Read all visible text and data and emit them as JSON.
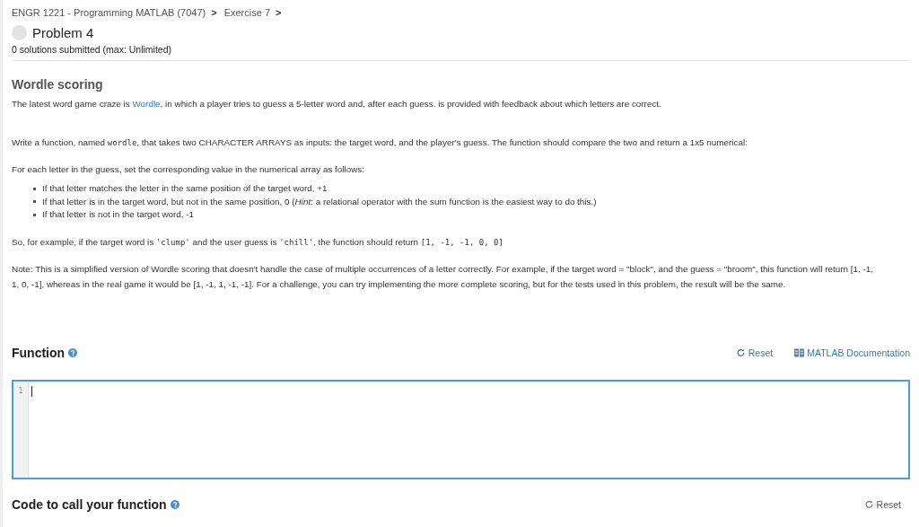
{
  "breadcrumb": [
    {
      "label": "ENGR 1221 - Programming MATLAB (7047)",
      "separator": ">"
    },
    {
      "label": "Exercise 7",
      "separator": ">"
    }
  ],
  "problem": {
    "title": "Problem 4",
    "submitted": "0 solutions submitted (max: Unlimited)"
  },
  "description": {
    "heading": "Wordle scoring",
    "paragraphs": [
      {
        "kind": "text",
        "segments": [
          {
            "kind": "plain",
            "text": "The latest word game craze is "
          },
          {
            "kind": "link",
            "text": "Wordle"
          },
          {
            "kind": "plain",
            "text": ", in which a player tries to guess a 5-letter word and, after each guess. is provided with feedback about which letters are correct."
          }
        ]
      },
      {
        "kind": "text",
        "segments": [
          {
            "kind": "plain",
            "text": "Write a function, named "
          },
          {
            "kind": "code",
            "text": "wordle"
          },
          {
            "kind": "plain",
            "text": ", that takes two CHARACTER ARRAYS as inputs: the target word, and the player's guess. The function should compare the two and return a 1x5 numerical:"
          }
        ]
      },
      {
        "kind": "text",
        "segments": [
          {
            "kind": "plain",
            "text": "For each letter in the guess, set the corresponding value in the numerical array as follows:"
          }
        ]
      },
      {
        "kind": "list",
        "items": [
          "If that letter matches the letter in the same position of the target word, +1",
          "If that letter is in the target word, but not in the same position, 0 (*Hint*: a relational operator with the sum function is the easiest way to do this.)",
          "If that letter is not in the target word, -1"
        ]
      },
      {
        "kind": "text",
        "segments": [
          {
            "kind": "plain",
            "text": "So, for example, if the target word is "
          },
          {
            "kind": "code",
            "text": "'clump'"
          },
          {
            "kind": "plain",
            "text": " and the user guess is "
          },
          {
            "kind": "code",
            "text": "'chill'"
          },
          {
            "kind": "plain",
            "text": ", the function should return "
          },
          {
            "kind": "code",
            "text": "[1, -1, -1, 0, 0]"
          }
        ]
      },
      {
        "kind": "text",
        "segments": [
          {
            "kind": "plain",
            "text": "Note: This is a simplified version of Wordle scoring that doesn't handle the case of multiple occurrences of a letter correctly. For example, if the target word = \"block\", and the guess = \"broom\", this function will return [1, -1, 1, 0, -1], whereas in the real game it would be [1, -1, 1, -1, -1]. For a challenge, you can try implementing the more complete scoring, but for the tests used in this problem, the result will be the same."
          }
        ]
      }
    ]
  },
  "function_section": {
    "heading": "Function",
    "reset": "Reset",
    "docs": "MATLAB Documentation",
    "line_numbers": [
      "1"
    ]
  },
  "call_section": {
    "heading": "Code to call your function",
    "reset": "Reset"
  }
}
